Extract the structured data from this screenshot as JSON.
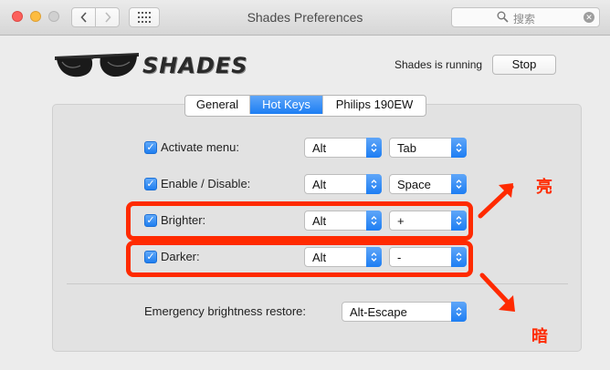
{
  "window": {
    "title": "Shades Preferences",
    "search_placeholder": "搜索"
  },
  "header": {
    "brand": "SHADES",
    "status": "Shades is running",
    "stop_label": "Stop"
  },
  "tabs": [
    {
      "label": "General",
      "active": false
    },
    {
      "label": "Hot Keys",
      "active": true
    },
    {
      "label": "Philips 190EW",
      "active": false
    }
  ],
  "hotkeys": [
    {
      "label": "Activate menu:",
      "checked": true,
      "modifier": "Alt",
      "key": "Tab"
    },
    {
      "label": "Enable / Disable:",
      "checked": true,
      "modifier": "Alt",
      "key": "Space"
    },
    {
      "label": "Brighter:",
      "checked": true,
      "modifier": "Alt",
      "key": "+"
    },
    {
      "label": "Darker:",
      "checked": true,
      "modifier": "Alt",
      "key": "-"
    }
  ],
  "emergency": {
    "label": "Emergency brightness restore:",
    "value": "Alt-Escape"
  },
  "annotations": {
    "brighter_note": "亮",
    "darker_note": "暗",
    "color": "#ff2a00"
  },
  "colors": {
    "accent": "#1d7ef3"
  }
}
